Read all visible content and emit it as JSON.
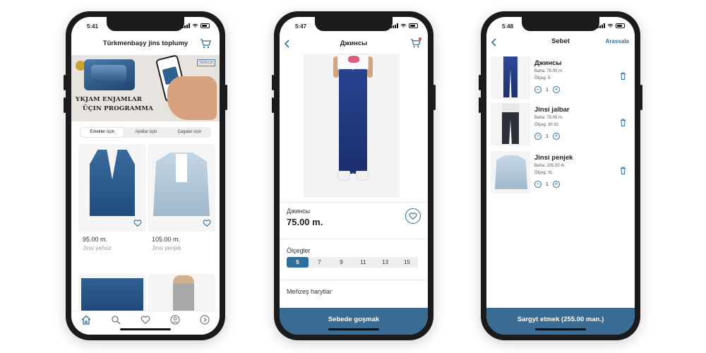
{
  "colors": {
    "accent": "#3a6b92",
    "accent_active": "#2f6d9c",
    "frame": "#1b1b1d",
    "badge": "#e74c3c"
  },
  "screen1": {
    "time": "5:41",
    "title": "Türkmenbaşy jins toplumy",
    "banner": {
      "line1": "YKJAM ENJAMLAR",
      "line2": "ÜÇIN PROGRAMMA",
      "tag": "TÄZELIK"
    },
    "tabs": [
      "Erkekler üçin",
      "Aýallar üçin",
      "Çagalar üçin"
    ],
    "active_tab": 0,
    "products": [
      {
        "price": "95.00 m.",
        "name": "Jinsi ýeňsiz"
      },
      {
        "price": "105.00 m.",
        "name": "Jinsi penjek"
      }
    ],
    "tabbar": [
      "home-icon",
      "search-icon",
      "heart-icon",
      "user-icon",
      "info-icon"
    ]
  },
  "screen2": {
    "time": "5:47",
    "title": "Джинсы",
    "product_name": "Джинсы",
    "price": "75.00 m.",
    "sizes_title": "Ölçegler",
    "sizes": [
      "5",
      "7",
      "9",
      "11",
      "13",
      "15"
    ],
    "selected_size": "5",
    "similar_title": "Meňzeş harytlar",
    "cta": "Sebede goşmak"
  },
  "screen3": {
    "time": "5:48",
    "title": "Sebet",
    "clear": "Arassala",
    "items": [
      {
        "name": "Джинсы",
        "price": "Baha: 75.00 m.",
        "size": "Ölçeg: 5",
        "qty": "1"
      },
      {
        "name": "Jinsi jalbar",
        "price": "Baha: 75.00 m.",
        "size": "Ölçeg: 30 32",
        "qty": "1"
      },
      {
        "name": "Jinsi penjek",
        "price": "Baha: 105.00 m.",
        "size": "Ölçeg: XL",
        "qty": "1"
      }
    ],
    "order": "Sargyt etmek (255.00 man.)"
  }
}
